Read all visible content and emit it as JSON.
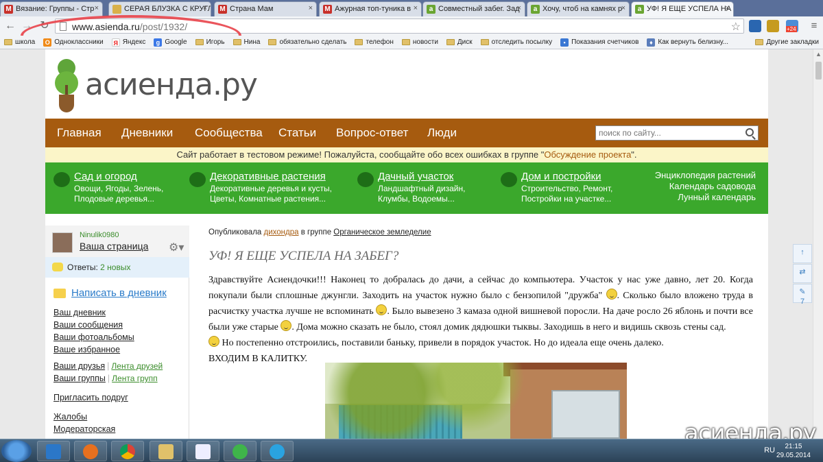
{
  "browser": {
    "tabs": [
      {
        "label": "Вязание: Группы - Стр",
        "icon": "mail-icon"
      },
      {
        "label": "СЕРАЯ БЛУЗКА С КРУГЛ",
        "icon": "doc-icon"
      },
      {
        "label": "Страна Мам",
        "icon": "mail-icon"
      },
      {
        "label": "Ажурная топ-туника в",
        "icon": "mail-icon"
      },
      {
        "label": "Совместный забег. Зад",
        "icon": "asienda-icon"
      },
      {
        "label": "Хочу, чтоб на камнях р",
        "icon": "asienda-icon"
      },
      {
        "label": "УФ! Я ЕЩЕ УСПЕЛА НА",
        "icon": "asienda-icon"
      }
    ],
    "url_host": "www.asienda.ru",
    "url_path": "/post/1932/",
    "badge": "+24",
    "bookmarks": [
      "школа",
      "Одноклассники",
      "Яндекс",
      "Google",
      "Игорь",
      "Нина",
      "обязательно сделать",
      "телефон",
      "новости",
      "Диск",
      "отследить посылку",
      "Показания счетчиков",
      "Как вернуть белизну..."
    ],
    "other_bookmarks": "Другие закладки"
  },
  "site": {
    "logo_text": "асиенда.ру",
    "nav": [
      "Главная",
      "Дневники",
      "Сообщества",
      "Статьи",
      "Вопрос-ответ",
      "Люди"
    ],
    "search_placeholder": "поиск по сайту...",
    "notice_prefix": "Сайт работает в тестовом режиме! Пожалуйста, сообщайте обо всех ошибках в группе \"",
    "notice_link": "Обсуждение проекта",
    "notice_suffix": "\".",
    "categories": [
      {
        "title": "Сад и огород",
        "line1": "Овощи, Ягоды, Зелень,",
        "line2": "Плодовые деревья..."
      },
      {
        "title": "Декоративные растения",
        "line1": "Декоративные деревья и кусты,",
        "line2": "Цветы, Комнатные растения..."
      },
      {
        "title": "Дачный участок",
        "line1": "Ландшафтный дизайн,",
        "line2": "Клумбы, Водоемы..."
      },
      {
        "title": "Дом и постройки",
        "line1": "Строительство, Ремонт,",
        "line2": "Постройки на участке..."
      }
    ],
    "extra_links": [
      "Энциклопедия растений",
      "Календарь садовода",
      "Лунный календарь"
    ]
  },
  "sidebar": {
    "username": "Ninulik0980",
    "my_page": "Ваша страница",
    "answers_label": "Ответы:",
    "answers_link": "2 новых",
    "write": "Написать в дневник",
    "links": [
      "Ваш дневник",
      "Ваши сообщения",
      "Ваши фотоальбомы",
      "Ваше избранное"
    ],
    "friends": "Ваши друзья",
    "friends_feed": "Лента друзей",
    "groups": "Ваши группы",
    "groups_feed": "Лента групп",
    "invite": "Пригласить подруг",
    "complaints": "Жалобы",
    "moderator": "Модераторская"
  },
  "article": {
    "meta_published": "Опубликовала",
    "meta_author": "дихондра",
    "meta_in_group": "в группе",
    "meta_group": "Органическое земледелие",
    "title": "УФ! Я ЕЩЕ УСПЕЛА НА ЗАБЕГ?",
    "p1": "Здравствуйте Асиендочки!!! Наконец то добралась до дачи, а сейчас до компьютера. Участок у нас уже давно, лет 20. Когда покупали были сплошные джунгли. Заходить на участок нужно было с бензопилой \"дружба\"",
    "p2": ". Сколько было вложено труда в расчистку участка лучше не вспоминать",
    "p3": ". Было вывезено 3 камаза одной вишневой поросли. На даче росло 26 яблонь и почти все были уже старые",
    "p4": ". Дома можно сказать не было, стоял домик дядюшки тыквы. Заходишь в него и видишь сквозь стены сад.",
    "p5": " Но постепенно отстроились, поставили баньку, привели в порядок участок. Но до идеала еще очень далеко.",
    "p6": "ВХОДИМ В КАЛИТКУ."
  },
  "float": {
    "count": "7"
  },
  "watermark": "асиенда.ру",
  "taskbar": {
    "lang": "RU",
    "time": "21:15",
    "date": "29.05.2014"
  }
}
